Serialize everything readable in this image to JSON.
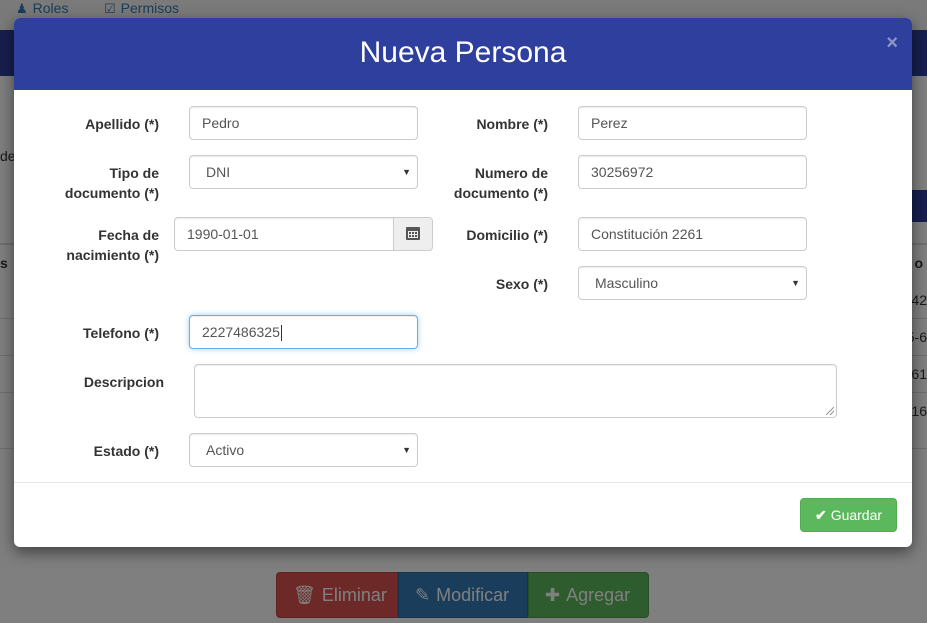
{
  "background": {
    "nav": {
      "roles": "Roles",
      "permisos": "Permisos"
    },
    "side_fragments": {
      "de": "de",
      "s": "s",
      "o": "o"
    },
    "table_fragments": [
      "42",
      "5-6",
      "61",
      "16"
    ],
    "buttons": {
      "eliminar": "Eliminar",
      "modificar": "Modificar",
      "agregar": "Agregar"
    }
  },
  "modal": {
    "title": "Nueva Persona",
    "close": "×",
    "form": {
      "apellido": {
        "label": "Apellido (*)",
        "value": "Pedro"
      },
      "nombre": {
        "label": "Nombre (*)",
        "value": "Perez"
      },
      "tipo_documento": {
        "label_line1": "Tipo de",
        "label_line2": "documento (*)",
        "value": "DNI"
      },
      "numero_documento": {
        "label_line1": "Numero de",
        "label_line2": "documento (*)",
        "value": "30256972"
      },
      "fecha_nacimiento": {
        "label_line1": "Fecha de",
        "label_line2": "nacimiento (*)",
        "value": "1990-01-01"
      },
      "domicilio": {
        "label": "Domicilio (*)",
        "value": "Constitución 2261"
      },
      "sexo": {
        "label": "Sexo (*)",
        "value": "Masculino"
      },
      "telefono": {
        "label": "Telefono (*)",
        "value": "2227486325"
      },
      "descripcion": {
        "label": "Descripcion",
        "value": ""
      },
      "estado": {
        "label": "Estado (*)",
        "value": "Activo"
      }
    },
    "footer": {
      "guardar": "Guardar"
    }
  },
  "icons": {
    "roles": "user-icon",
    "permisos": "checkbox-icon",
    "calendar": "calendar-icon",
    "caret": "caret-down-icon",
    "check": "check-icon",
    "trash": "trash-icon",
    "edit": "edit-icon",
    "plus": "plus-icon"
  },
  "colors": {
    "primary": "#2e3f9e",
    "success": "#5cb85c",
    "danger": "#d9534f",
    "info": "#337ab7"
  }
}
